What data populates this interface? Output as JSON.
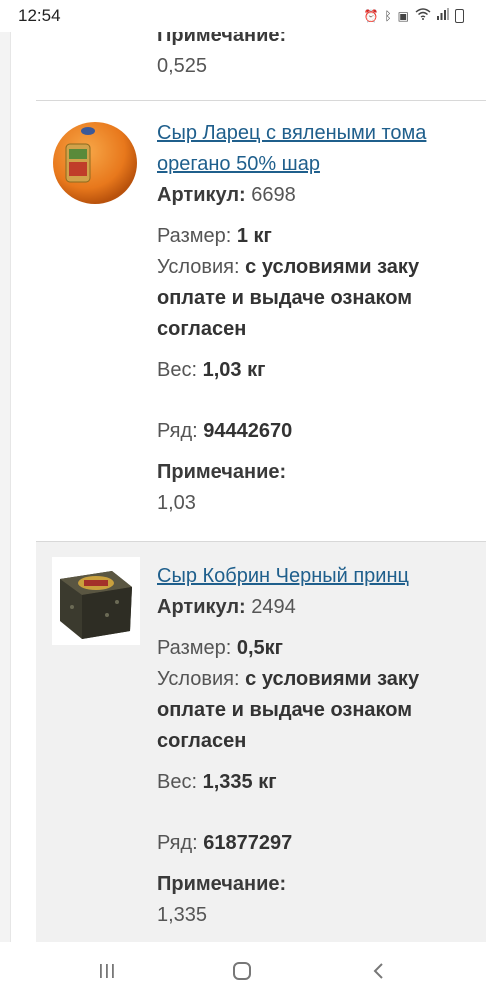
{
  "status_bar": {
    "time": "12:54",
    "icons": [
      "alarm-icon",
      "bluetooth-icon",
      "nfc-icon",
      "wifi-icon",
      "signal-icon",
      "battery-icon"
    ]
  },
  "labels": {
    "article": "Артикул:",
    "size": "Размер:",
    "conditions": "Условия:",
    "weight": "Вес:",
    "row": "Ряд:",
    "note": "Примечание:"
  },
  "top_partial": {
    "note_value": "0,525"
  },
  "products": [
    {
      "title_line1": "Сыр Ларец с вялеными тома",
      "title_line2": "орегано 50% шар",
      "article": "6698",
      "size": "1 кг",
      "conditions_line1": "с условиями заку",
      "conditions_line2": "оплате и выдаче ознаком",
      "conditions_line3": "согласен",
      "weight": "1,03 кг",
      "row": "94442670",
      "note_value": "1,03"
    },
    {
      "title_line1": "Сыр Кобрин Черный принц",
      "article": "2494",
      "size": "0,5кг",
      "conditions_line1": "с условиями заку",
      "conditions_line2": "оплате и выдаче ознаком",
      "conditions_line3": "согласен",
      "weight": "1,335 кг",
      "row": "61877297",
      "note_value": "1,335"
    }
  ],
  "nav": {
    "icons": [
      "recent-apps-icon",
      "home-icon",
      "back-icon"
    ]
  }
}
